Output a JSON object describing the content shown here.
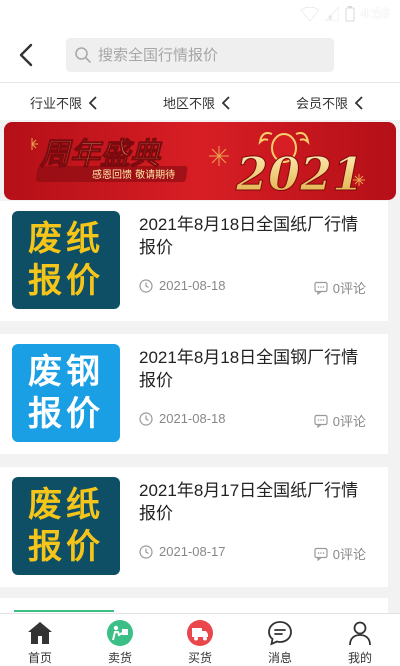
{
  "status_bar": {
    "time": "4:59"
  },
  "search": {
    "placeholder": "搜索全国行情报价"
  },
  "filters": [
    {
      "label": "行业不限"
    },
    {
      "label": "地区不限"
    },
    {
      "label": "会员不限"
    }
  ],
  "banner": {
    "title": "周年盛典",
    "subtitle": "感恩回馈 敬请期待",
    "year": "2021"
  },
  "articles": [
    {
      "thumb_line1": "废纸",
      "thumb_line2": "报价",
      "thumb_style": "dark",
      "title": "2021年8月18日全国纸厂行情报价",
      "date": "2021-08-18",
      "comments": "0评论"
    },
    {
      "thumb_line1": "废钢",
      "thumb_line2": "报价",
      "thumb_style": "light",
      "title": "2021年8月18日全国钢厂行情报价",
      "date": "2021-08-18",
      "comments": "0评论"
    },
    {
      "thumb_line1": "废纸",
      "thumb_line2": "报价",
      "thumb_style": "dark",
      "title": "2021年8月17日全国纸厂行情报价",
      "date": "2021-08-17",
      "comments": "0评论"
    }
  ],
  "tabs": [
    {
      "label": "首页",
      "icon": "home-icon"
    },
    {
      "label": "卖货",
      "icon": "sell-icon"
    },
    {
      "label": "买货",
      "icon": "buy-icon"
    },
    {
      "label": "消息",
      "icon": "message-icon"
    },
    {
      "label": "我的",
      "icon": "profile-icon"
    }
  ],
  "colors": {
    "accent_green": "#3cbf87",
    "sell_green": "#3cbf87",
    "buy_red": "#e9474b",
    "banner_red": "#c8141b"
  }
}
